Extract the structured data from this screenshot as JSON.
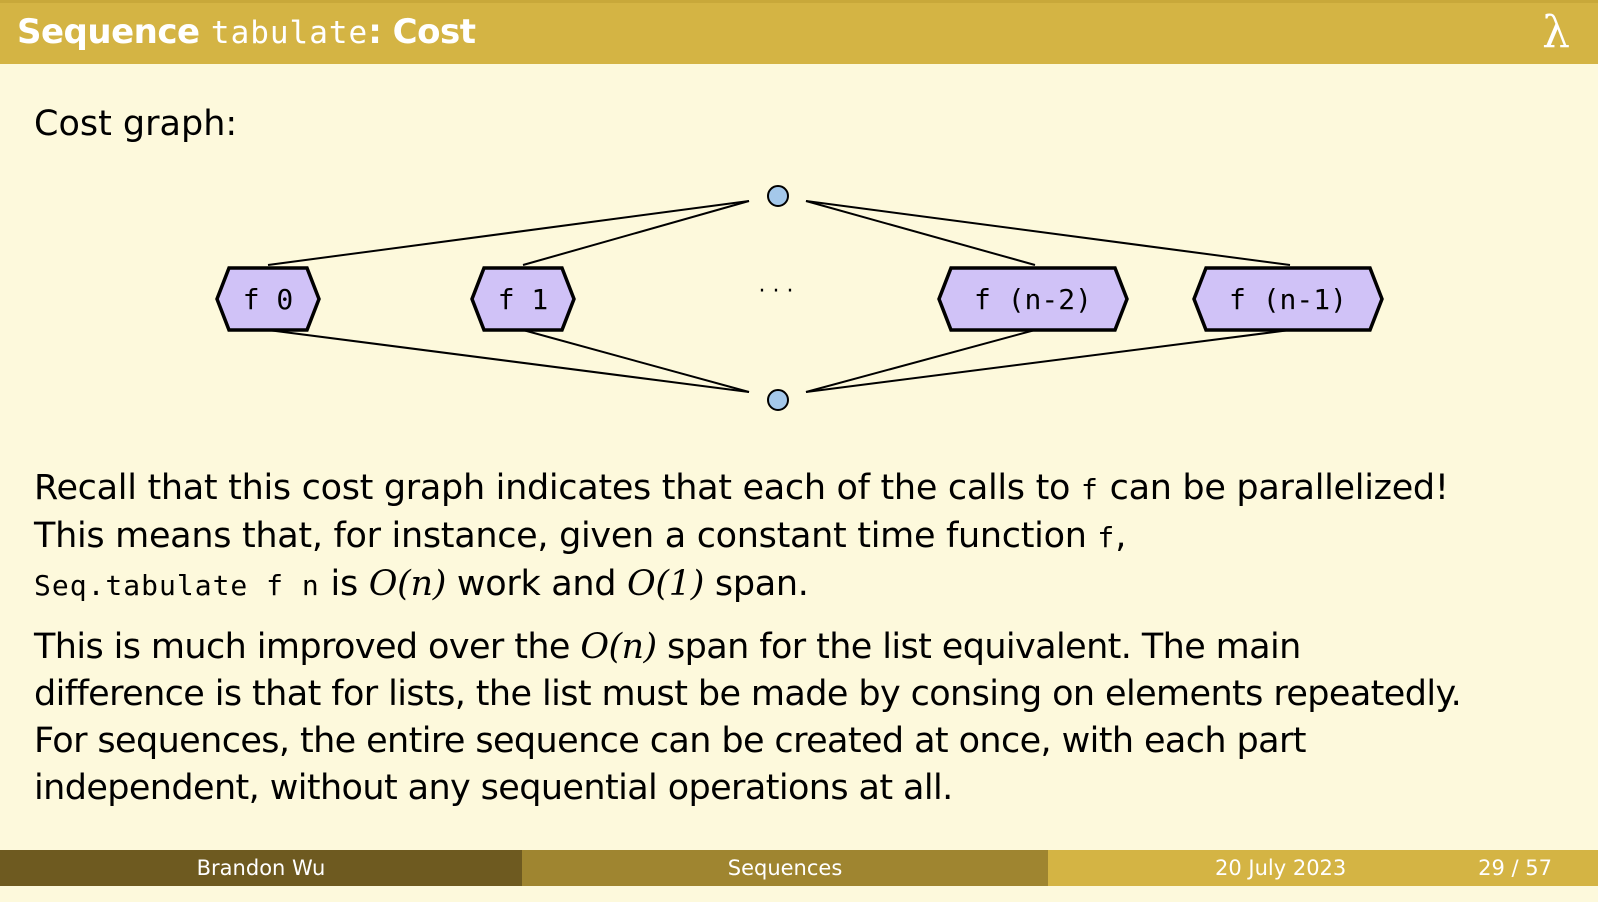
{
  "slide": {
    "title_prefix": "Sequence ",
    "title_code": "tabulate",
    "title_suffix": ": Cost",
    "logo_symbol": "λ"
  },
  "intro": "Cost graph:",
  "graph": {
    "nodes": [
      "f 0",
      "f 1",
      "f (n-2)",
      "f (n-1)"
    ],
    "ellipsis": "· · ·"
  },
  "paragraph1": {
    "line1_a": "Recall that this cost graph indicates that each of the calls to ",
    "line1_code": "f",
    "line1_b": " can be parallelized!",
    "line2_a": "This means that, for instance, given a constant time function ",
    "line2_code": "f",
    "line2_b": ",",
    "line3_code": "Seq.tabulate f n",
    "line3_a": " is ",
    "line3_math1": "O(n)",
    "line3_b": " work and ",
    "line3_math2": "O(1)",
    "line3_c": " span."
  },
  "paragraph2": {
    "line1_a": "This is much improved over the ",
    "line1_math": "O(n)",
    "line1_b": " span for the list equivalent. The main",
    "line2": "difference is that for lists, the list must be made by consing on elements repeatedly.",
    "line3": "For sequences, the entire sequence can be created at once, with each part",
    "line4": "independent, without any sequential operations at all."
  },
  "footer": {
    "author": "Brandon Wu",
    "title": "Sequences",
    "date": "20 July 2023",
    "page": "29 / 57"
  },
  "colors": {
    "title_bar": "#d4b444",
    "background": "#fdf9dc",
    "node_fill": "#d0c2f7",
    "dot_fill": "#a4c8ea",
    "footer_dark": "#6e5a20",
    "footer_mid": "#9f8530",
    "footer_light": "#d4b444"
  }
}
